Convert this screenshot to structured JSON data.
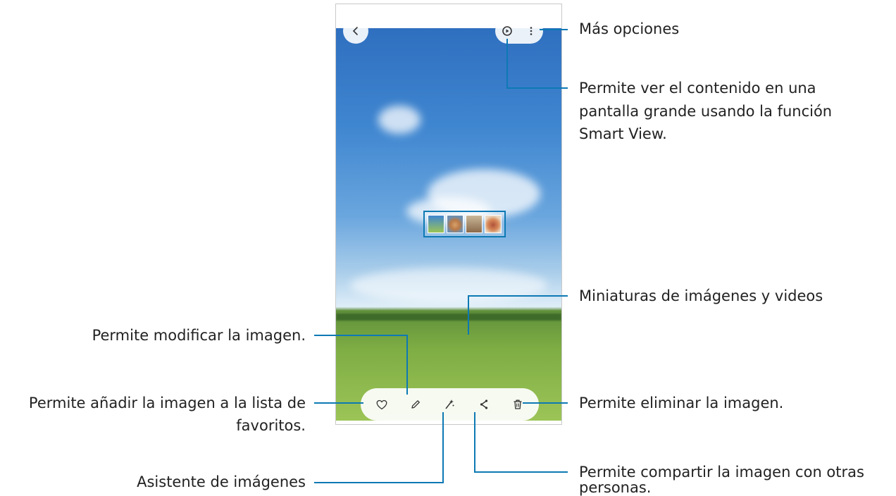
{
  "labels": {
    "more_options": "Más opciones",
    "smart_view_line1": "Permite ver el contenido en una",
    "smart_view_line2": "pantalla grande usando la función",
    "smart_view_line3": "Smart View.",
    "thumbnails": "Miniaturas de imágenes y videos",
    "edit": "Permite modificar la imagen.",
    "favorite_line1": "Permite añadir la imagen a la lista de",
    "favorite_line2": "favoritos.",
    "delete": "Permite eliminar la imagen.",
    "assistant": "Asistente de imágenes",
    "share_line1": "Permite compartir la imagen con otras",
    "share_line2": "personas."
  },
  "toolbar_icons": [
    "heart-icon",
    "pencil-icon",
    "sparkle-icon",
    "share-icon",
    "trash-icon"
  ],
  "top_icons": [
    "back-icon",
    "cast-icon",
    "more-vertical-icon"
  ],
  "colors": {
    "leader_line": "#0d79b4",
    "sky": "#3f86d0",
    "grass": "#7fae45"
  }
}
